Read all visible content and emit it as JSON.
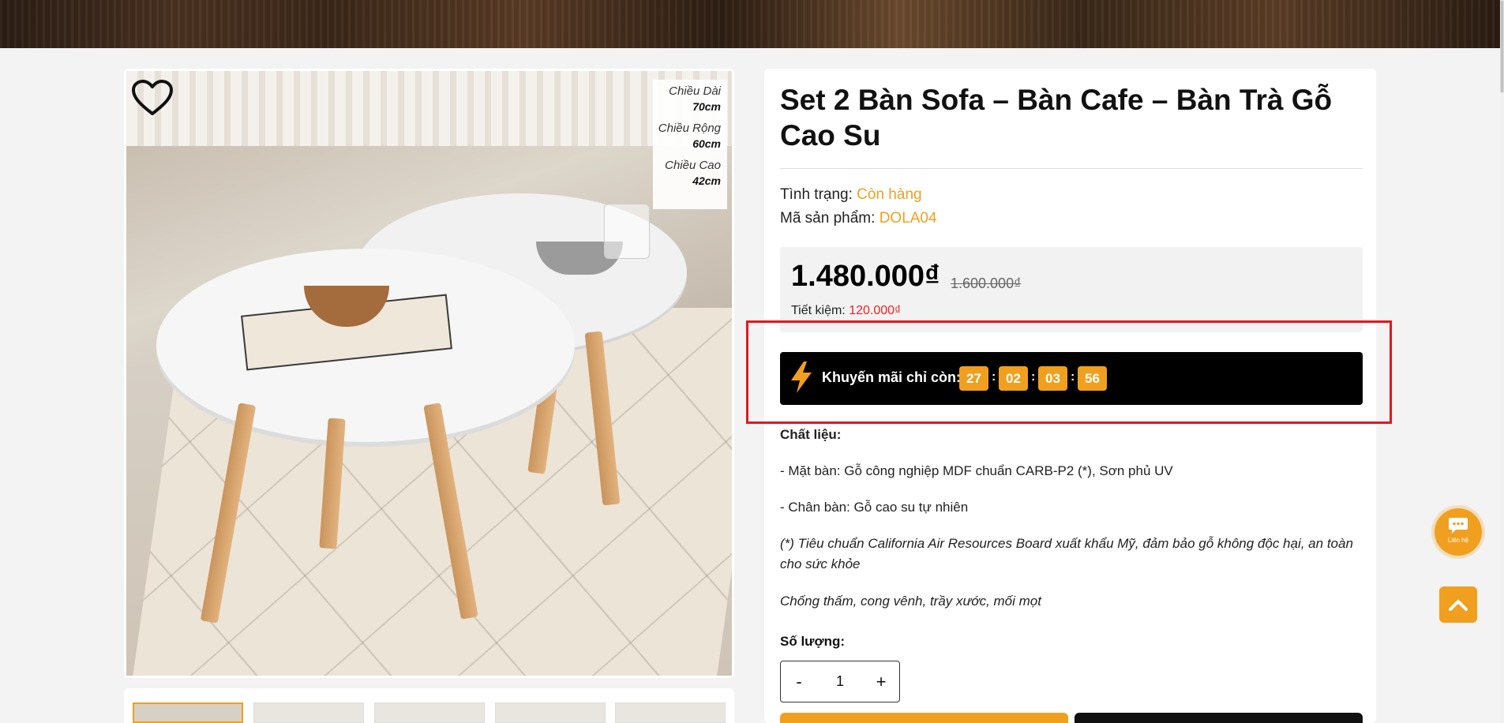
{
  "product": {
    "title": "Set 2 Bàn Sofa – Bàn Cafe – Bàn Trà Gỗ Cao Su",
    "status_label": "Tình trạng:",
    "status_value": "Còn hàng",
    "sku_label": "Mã sản phẩm:",
    "sku_value": "DOLA04",
    "price": "1.480.000₫",
    "old_price": "1.600.000₫",
    "saving_label": "Tiết kiệm:",
    "saving_value": "120.000₫"
  },
  "dimensions": [
    {
      "label": "Chiều Dài",
      "value": "70cm"
    },
    {
      "label": "Chiều Rộng",
      "value": "60cm"
    },
    {
      "label": "Chiều Cao",
      "value": "42cm"
    }
  ],
  "promo": {
    "label": "Khuyến mãi chỉ còn:",
    "countdown": [
      "27",
      "02",
      "03",
      "56"
    ],
    "separator": ":"
  },
  "description": {
    "material_heading": "Chất liệu:",
    "line1": "- Mặt bàn: Gỗ công nghiệp MDF chuẩn CARB-P2 (*), Sơn phủ UV",
    "line2": "- Chân bàn: Gỗ cao su tự nhiên",
    "note": "(*) Tiêu chuẩn California Air Resources Board xuất khẩu Mỹ, đảm bảo gỗ không độc hại, an toàn cho sức khỏe",
    "features": "Chống thấm, cong vênh, trầy xước, mối mọt"
  },
  "quantity": {
    "label": "Số lượng:",
    "minus": "-",
    "value": "1",
    "plus": "+"
  },
  "floating": {
    "chat_label": "Liên hệ"
  },
  "colors": {
    "accent": "#f0a01e",
    "highlight": "#e5161d",
    "promo_bg": "#000000"
  },
  "icons": {
    "wishlist": "heart-icon",
    "promo": "lightning-icon",
    "chat": "chat-icon",
    "back_to_top": "chevron-up-icon"
  }
}
